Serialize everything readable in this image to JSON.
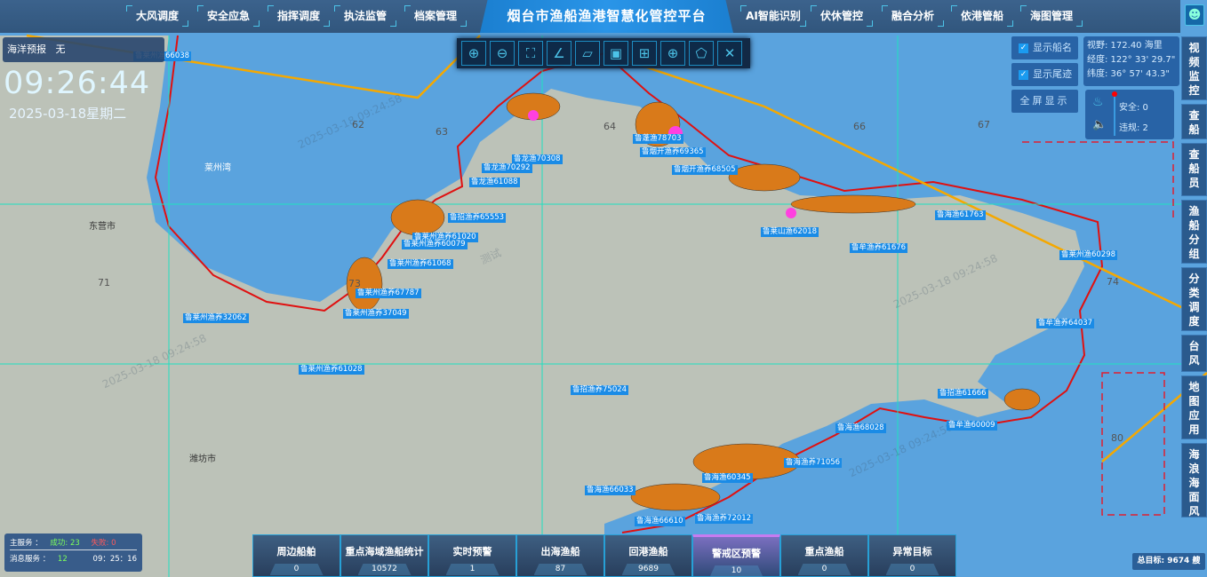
{
  "header": {
    "title": "烟台市渔船渔港智慧化管控平台",
    "nav_left": [
      "大风调度",
      "安全应急",
      "指挥调度",
      "执法监管",
      "档案管理"
    ],
    "nav_right": [
      "AI智能识别",
      "伏休管控",
      "融合分析",
      "依港管船",
      "海图管理"
    ],
    "user_icon": "user-icon"
  },
  "forecast": {
    "label": "海洋预报",
    "value": "无"
  },
  "clock": {
    "time": "09:26:44",
    "date": "2025-03-18星期二"
  },
  "toolbar": {
    "tools": [
      "zoom-in",
      "zoom-out",
      "full-extent",
      "measure-line",
      "ruler",
      "select-rect",
      "add-point",
      "circle-select",
      "polygon-select",
      "clear"
    ]
  },
  "toggles": {
    "ship_name": "显示船名",
    "track": "显示尾迹",
    "fullscreen": "全屏显示"
  },
  "view_info": {
    "range": "视野: 172.40 海里",
    "lon": "经度: 122° 33' 29.7\"",
    "lat": "纬度: 36° 57' 43.3\""
  },
  "alarm": {
    "safe": "安全: 0",
    "violation": "违规: 2"
  },
  "side_menu": [
    "视频监控",
    "查船",
    "查船员",
    "渔船分组",
    "分类调度",
    "台风",
    "地图应用",
    "海浪海面风"
  ],
  "service": {
    "main_label": "主服务 ：",
    "success": "成功: 23",
    "fail": "失败: 0",
    "msg_label": "消息服务 ：",
    "msg_count": "12",
    "time": "09：25：16"
  },
  "stats": [
    {
      "label": "周边船舶",
      "value": "0"
    },
    {
      "label": "重点海域渔船统计",
      "value": "10572"
    },
    {
      "label": "实时预警",
      "value": "1"
    },
    {
      "label": "出海渔船",
      "value": "87"
    },
    {
      "label": "回港渔船",
      "value": "9689"
    },
    {
      "label": "警戒区预警",
      "value": "10"
    },
    {
      "label": "重点渔船",
      "value": "0"
    },
    {
      "label": "异常目标",
      "value": "0"
    }
  ],
  "total": "总目标: 9674 艘",
  "map": {
    "watermark": "2025-03-18 09:24:58",
    "test": "测试",
    "grid": [
      "62",
      "63",
      "64",
      "66",
      "67",
      "71",
      "73",
      "74",
      "80"
    ],
    "places": [
      "东营市",
      "潍坊市",
      "莱州湾"
    ],
    "vessels": [
      "鲁莱州渔66038",
      "鲁龙渔70308",
      "鲁龙渔70292",
      "鲁龙渔61088",
      "鲁蓬渔78703",
      "鲁烟开渔养69365",
      "鲁烟开渔养68505",
      "鲁招渔养65553",
      "鲁莱州渔养61020",
      "鲁莱州渔养60079",
      "鲁莱州渔养61068",
      "鲁莱州渔养67787",
      "鲁莱州渔养37049",
      "鲁莱州渔养32062",
      "鲁莱州渔养61028",
      "鲁招渔养75024",
      "鲁莱山渔62018",
      "鲁牟渔养61676",
      "鲁海渔61763",
      "鲁莱州渔60298",
      "鲁牟渔养64037",
      "鲁招渔61666",
      "鲁牟渔60009",
      "鲁海渔68028",
      "鲁海渔养71056",
      "鲁海渔60345",
      "鲁海渔66610",
      "鲁海渔养72012",
      "鲁海渔66033"
    ]
  }
}
